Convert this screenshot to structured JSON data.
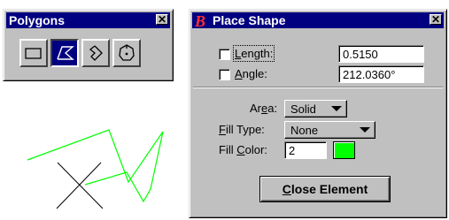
{
  "polygons_palette": {
    "title": "Polygons",
    "close_glyph": "✕",
    "tools": [
      {
        "name": "rectangle-tool-icon",
        "active": false
      },
      {
        "name": "shape-tool-icon",
        "active": true
      },
      {
        "name": "orthogonal-shape-tool-icon",
        "active": false
      },
      {
        "name": "regular-polygon-tool-icon",
        "active": false
      }
    ]
  },
  "place_shape": {
    "app_icon": "microstation-logo-icon",
    "title": "Place Shape",
    "close_glyph": "✕",
    "length": {
      "label_pre": "",
      "label_ul": "L",
      "label_post": "ength:",
      "value": "0.5150",
      "checked": false
    },
    "angle": {
      "label_pre": "",
      "label_ul": "A",
      "label_post": "ngle:",
      "value": "212.0360°",
      "checked": false
    },
    "area": {
      "label_pre": "Ar",
      "label_ul": "e",
      "label_post": "a:",
      "value": "Solid"
    },
    "fill_type": {
      "label_pre": "",
      "label_ul": "F",
      "label_post": "ill Type:",
      "value": "None"
    },
    "fill_color": {
      "label_pre": "Fill ",
      "label_ul": "C",
      "label_post": "olor:",
      "value": "2",
      "swatch": "#00ff00"
    },
    "close_button": {
      "label_ul": "C",
      "label_post": "lose Element"
    }
  },
  "canvas": {
    "shape_color": "#00ff00",
    "cursor_color": "#000000"
  }
}
